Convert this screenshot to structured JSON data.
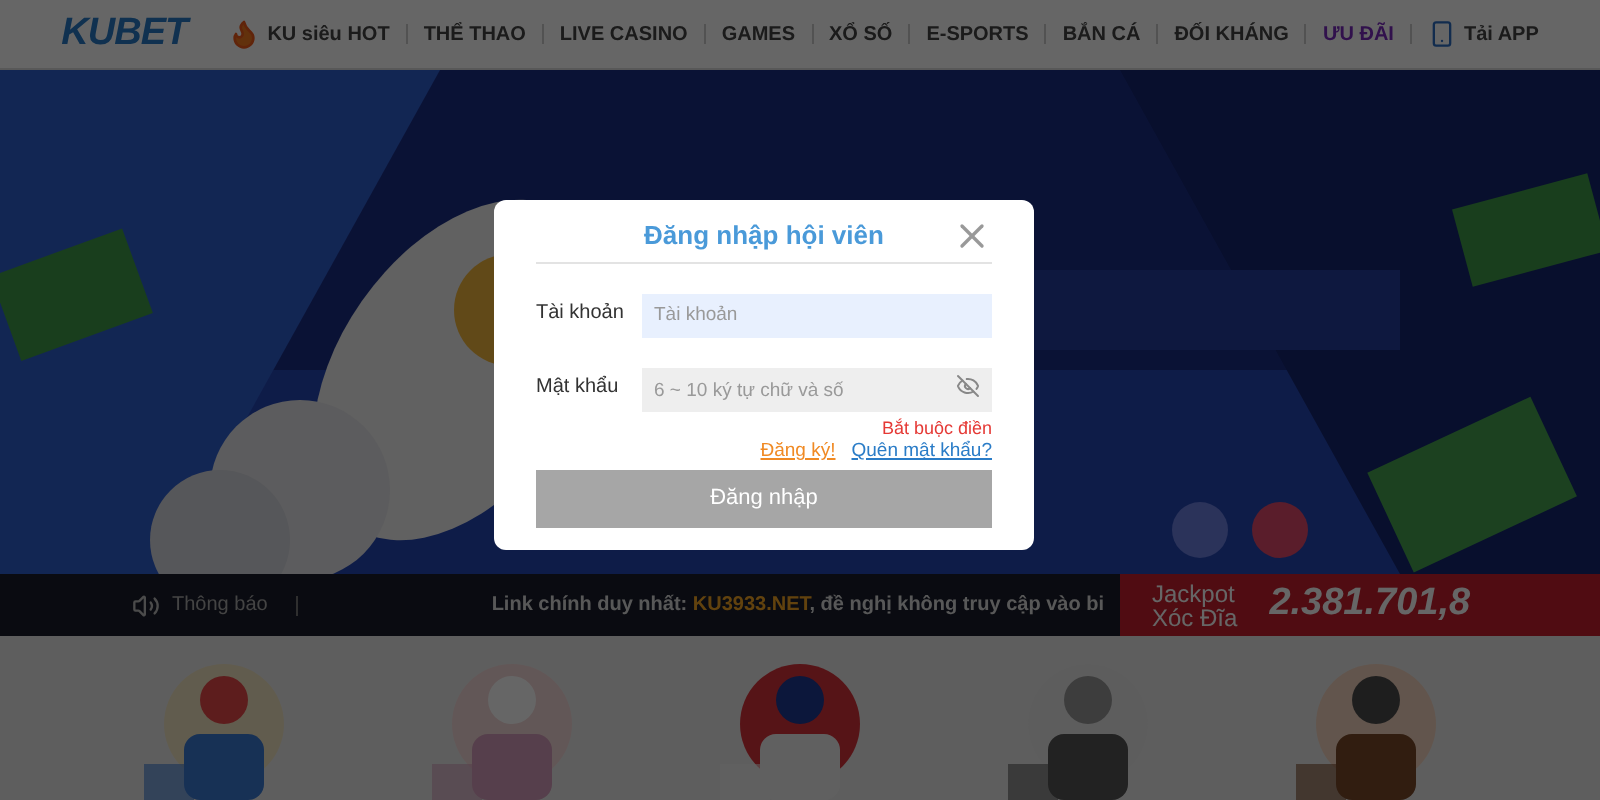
{
  "nav": {
    "logo": "KUBET",
    "items": [
      {
        "label": "KU siêu HOT",
        "kind": "hot"
      },
      {
        "label": "THỂ THAO",
        "kind": "plain"
      },
      {
        "label": "LIVE CASINO",
        "kind": "plain"
      },
      {
        "label": "GAMES",
        "kind": "plain"
      },
      {
        "label": "XỔ SỐ",
        "kind": "plain"
      },
      {
        "label": "E-SPORTS",
        "kind": "plain"
      },
      {
        "label": "BẮN CÁ",
        "kind": "plain"
      },
      {
        "label": "ĐỐI KHÁNG",
        "kind": "plain"
      },
      {
        "label": "ƯU ĐÃI",
        "kind": "promo"
      },
      {
        "label": "Tải APP",
        "kind": "app"
      }
    ]
  },
  "notice": {
    "label": "Thông báo",
    "message": [
      {
        "text": "Link chính duy nhất: ",
        "highlight": false
      },
      {
        "text": "KU3933.NET",
        "highlight": true
      },
      {
        "text": ", đề nghị không truy cập vào bi",
        "highlight": false
      }
    ],
    "jackpot": {
      "lines": [
        "Jackpot",
        "Xóc Đĩa"
      ],
      "value": "2.381.701,8"
    }
  },
  "modal": {
    "title": "Đăng nhập hội viên",
    "fields": [
      {
        "label": "Tài khoản",
        "placeholder": "Tài khoản",
        "kind": "text"
      },
      {
        "label": "Mật khẩu",
        "placeholder": "6 ~ 10 ký tự chữ và số",
        "kind": "password"
      }
    ],
    "error": "Bắt buộc điền",
    "register": "Đăng ký!",
    "forgot": "Quên mật khẩu?",
    "submit": {
      "label": "Đăng nhập",
      "disabled": true
    }
  }
}
